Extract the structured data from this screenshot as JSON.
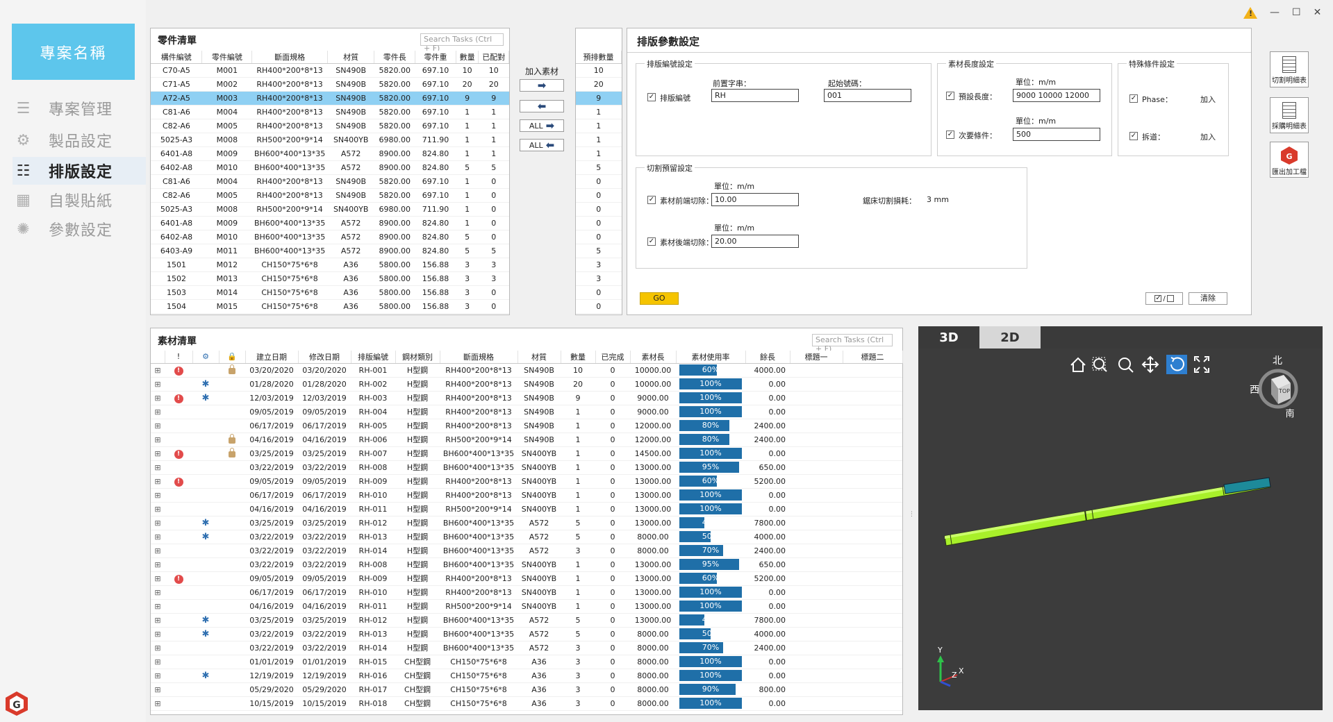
{
  "window": {
    "warning_icon": "warning-icon",
    "minimize": "—",
    "maximize": "☐",
    "close": "✕"
  },
  "sidebar": {
    "project_name": "專案名稱",
    "items": [
      {
        "label": "專案管理",
        "icon": "project-icon"
      },
      {
        "label": "製品設定",
        "icon": "product-icon"
      },
      {
        "label": "排版設定",
        "icon": "layout-icon",
        "active": true
      },
      {
        "label": "自製貼紙",
        "icon": "sticker-icon"
      },
      {
        "label": "參數設定",
        "icon": "settings-icon"
      }
    ]
  },
  "parts": {
    "title": "零件清單",
    "search_placeholder": "Search Tasks (Ctrl + F)",
    "columns": [
      "構件編號",
      "零件編號",
      "斷面規格",
      "材質",
      "零件長",
      "零件重",
      "數量",
      "已配對"
    ],
    "rows": [
      [
        "C70-A5",
        "M001",
        "RH400*200*8*13",
        "SN490B",
        "5820.00",
        "697.10",
        "10",
        "10"
      ],
      [
        "C71-A5",
        "M002",
        "RH400*200*8*13",
        "SN490B",
        "5820.00",
        "697.10",
        "20",
        "20"
      ],
      [
        "A72-A5",
        "M003",
        "RH400*200*8*13",
        "SN490B",
        "5820.00",
        "697.10",
        "9",
        "9"
      ],
      [
        "C81-A6",
        "M004",
        "RH400*200*8*13",
        "SN490B",
        "5820.00",
        "697.10",
        "1",
        "1"
      ],
      [
        "C82-A6",
        "M005",
        "RH400*200*8*13",
        "SN490B",
        "5820.00",
        "697.10",
        "1",
        "1"
      ],
      [
        "5025-A3",
        "M008",
        "RH500*200*9*14",
        "SN400YB",
        "6980.00",
        "711.90",
        "1",
        "1"
      ],
      [
        "6401-A8",
        "M009",
        "BH600*400*13*35",
        "A572",
        "8900.00",
        "824.80",
        "1",
        "1"
      ],
      [
        "6402-A8",
        "M010",
        "BH600*400*13*35",
        "A572",
        "8900.00",
        "824.80",
        "5",
        "5"
      ],
      [
        "C81-A6",
        "M004",
        "RH400*200*8*13",
        "SN490B",
        "5820.00",
        "697.10",
        "1",
        "0"
      ],
      [
        "C82-A6",
        "M005",
        "RH400*200*8*13",
        "SN490B",
        "5820.00",
        "697.10",
        "1",
        "0"
      ],
      [
        "5025-A3",
        "M008",
        "RH500*200*9*14",
        "SN400YB",
        "6980.00",
        "711.90",
        "1",
        "0"
      ],
      [
        "6401-A8",
        "M009",
        "BH600*400*13*35",
        "A572",
        "8900.00",
        "824.80",
        "1",
        "0"
      ],
      [
        "6402-A8",
        "M010",
        "BH600*400*13*35",
        "A572",
        "8900.00",
        "824.80",
        "5",
        "0"
      ],
      [
        "6403-A9",
        "M011",
        "BH600*400*13*35",
        "A572",
        "8900.00",
        "824.80",
        "5",
        "5"
      ],
      [
        "1501",
        "M012",
        "CH150*75*6*8",
        "A36",
        "5800.00",
        "156.88",
        "3",
        "3"
      ],
      [
        "1502",
        "M013",
        "CH150*75*6*8",
        "A36",
        "5800.00",
        "156.88",
        "3",
        "3"
      ],
      [
        "1503",
        "M014",
        "CH150*75*6*8",
        "A36",
        "5800.00",
        "156.88",
        "3",
        "0"
      ],
      [
        "1504",
        "M015",
        "CH150*75*6*8",
        "A36",
        "5800.00",
        "156.88",
        "3",
        "0"
      ]
    ],
    "selected_row": 2
  },
  "transfer": {
    "add_label": "加入素材",
    "right": "➡",
    "left": "⬅",
    "all_right": "ALL",
    "all_left": "ALL"
  },
  "prelist": {
    "title": "預排數量",
    "values": [
      "10",
      "20",
      "9",
      "1",
      "1",
      "1",
      "1",
      "5",
      "0",
      "0",
      "0",
      "0",
      "0",
      "5",
      "3",
      "3",
      "0",
      "0"
    ]
  },
  "params": {
    "title": "排版參數設定",
    "numbering": {
      "title": "排版編號設定",
      "checkbox": "排版編號",
      "prefix_label": "前置字串：",
      "prefix": "RH",
      "start_label": "起始號碼：",
      "start": "001"
    },
    "length": {
      "title": "素材長度設定",
      "unit1": "單位：m/m",
      "preset_label": "預設長度：",
      "preset": "9000  10000  12000",
      "unit2": "單位：m/m",
      "minimum_label": "次要條件：",
      "minimum": "500"
    },
    "special": {
      "title": "特殊條件設定",
      "phase_label": "Phase：",
      "phase_value": "加入",
      "splice_label": "拆道：",
      "splice_value": "加入"
    },
    "cut": {
      "title": "切割預留設定",
      "unit1": "單位：m/m",
      "front_label": "素材前端切除：",
      "front": "10.00",
      "kerf_label": "鋸床切割損耗：",
      "kerf": "3 mm",
      "unit2": "單位：m/m",
      "back_label": "素材後端切除：",
      "back": "20.00"
    },
    "go": "GO",
    "clear": "清除"
  },
  "tools": [
    {
      "label": "切割明細表"
    },
    {
      "label": "採購明細表"
    },
    {
      "label": "匯出加工檔"
    }
  ],
  "materials": {
    "title": "素材清單",
    "search_placeholder": "Search Tasks (Ctrl + F)",
    "columns": [
      "!",
      "⚙",
      "🔒",
      "建立日期",
      "修改日期",
      "排版編號",
      "鋼材類別",
      "斷面規格",
      "材質",
      "數量",
      "已完成",
      "素材長",
      "素材使用率",
      "餘長",
      "標題一",
      "標題二"
    ],
    "rows": [
      {
        "warn": true,
        "gear": false,
        "lock": true,
        "c": "03/20/2020",
        "m": "03/20/2020",
        "id": "RH-001",
        "type": "H型鋼",
        "spec": "RH400*200*8*13",
        "mat": "SN490B",
        "qty": "10",
        "done": "0",
        "len": "10000.00",
        "use": 60,
        "rem": "4000.00"
      },
      {
        "warn": false,
        "gear": true,
        "lock": false,
        "c": "01/28/2020",
        "m": "01/28/2020",
        "id": "RH-002",
        "type": "H型鋼",
        "spec": "RH400*200*8*13",
        "mat": "SN490B",
        "qty": "20",
        "done": "0",
        "len": "10000.00",
        "use": 100,
        "rem": "0.00"
      },
      {
        "warn": true,
        "gear": true,
        "lock": false,
        "c": "12/03/2019",
        "m": "12/03/2019",
        "id": "RH-003",
        "type": "H型鋼",
        "spec": "RH400*200*8*13",
        "mat": "SN490B",
        "qty": "9",
        "done": "0",
        "len": "9000.00",
        "use": 100,
        "rem": "0.00"
      },
      {
        "warn": false,
        "gear": false,
        "lock": false,
        "c": "09/05/2019",
        "m": "09/05/2019",
        "id": "RH-004",
        "type": "H型鋼",
        "spec": "RH400*200*8*13",
        "mat": "SN490B",
        "qty": "1",
        "done": "0",
        "len": "9000.00",
        "use": 100,
        "rem": "0.00"
      },
      {
        "warn": false,
        "gear": false,
        "lock": false,
        "c": "06/17/2019",
        "m": "06/17/2019",
        "id": "RH-005",
        "type": "H型鋼",
        "spec": "RH400*200*8*13",
        "mat": "SN490B",
        "qty": "1",
        "done": "0",
        "len": "12000.00",
        "use": 80,
        "rem": "2400.00"
      },
      {
        "warn": false,
        "gear": false,
        "lock": true,
        "c": "04/16/2019",
        "m": "04/16/2019",
        "id": "RH-006",
        "type": "H型鋼",
        "spec": "RH500*200*9*14",
        "mat": "SN490B",
        "qty": "1",
        "done": "0",
        "len": "12000.00",
        "use": 80,
        "rem": "2400.00"
      },
      {
        "warn": true,
        "gear": false,
        "lock": true,
        "c": "03/25/2019",
        "m": "03/25/2019",
        "id": "RH-007",
        "type": "H型鋼",
        "spec": "BH600*400*13*35",
        "mat": "SN400YB",
        "qty": "1",
        "done": "0",
        "len": "14500.00",
        "use": 100,
        "rem": "0.00"
      },
      {
        "warn": false,
        "gear": false,
        "lock": false,
        "c": "03/22/2019",
        "m": "03/22/2019",
        "id": "RH-008",
        "type": "H型鋼",
        "spec": "BH600*400*13*35",
        "mat": "SN400YB",
        "qty": "1",
        "done": "0",
        "len": "13000.00",
        "use": 95,
        "rem": "650.00"
      },
      {
        "warn": true,
        "gear": false,
        "lock": false,
        "c": "09/05/2019",
        "m": "09/05/2019",
        "id": "RH-009",
        "type": "H型鋼",
        "spec": "RH400*200*8*13",
        "mat": "SN400YB",
        "qty": "1",
        "done": "0",
        "len": "13000.00",
        "use": 60,
        "rem": "5200.00"
      },
      {
        "warn": false,
        "gear": false,
        "lock": false,
        "c": "06/17/2019",
        "m": "06/17/2019",
        "id": "RH-010",
        "type": "H型鋼",
        "spec": "RH400*200*8*13",
        "mat": "SN400YB",
        "qty": "1",
        "done": "0",
        "len": "13000.00",
        "use": 100,
        "rem": "0.00"
      },
      {
        "warn": false,
        "gear": false,
        "lock": false,
        "c": "04/16/2019",
        "m": "04/16/2019",
        "id": "RH-011",
        "type": "H型鋼",
        "spec": "RH500*200*9*14",
        "mat": "SN400YB",
        "qty": "1",
        "done": "0",
        "len": "13000.00",
        "use": 100,
        "rem": "0.00"
      },
      {
        "warn": false,
        "gear": true,
        "lock": false,
        "c": "03/25/2019",
        "m": "03/25/2019",
        "id": "RH-012",
        "type": "H型鋼",
        "spec": "BH600*400*13*35",
        "mat": "A572",
        "qty": "5",
        "done": "0",
        "len": "13000.00",
        "use": 40,
        "rem": "7800.00"
      },
      {
        "warn": false,
        "gear": true,
        "lock": false,
        "c": "03/22/2019",
        "m": "03/22/2019",
        "id": "RH-013",
        "type": "H型鋼",
        "spec": "BH600*400*13*35",
        "mat": "A572",
        "qty": "5",
        "done": "0",
        "len": "8000.00",
        "use": 50,
        "rem": "4000.00"
      },
      {
        "warn": false,
        "gear": false,
        "lock": false,
        "c": "03/22/2019",
        "m": "03/22/2019",
        "id": "RH-014",
        "type": "H型鋼",
        "spec": "BH600*400*13*35",
        "mat": "A572",
        "qty": "3",
        "done": "0",
        "len": "8000.00",
        "use": 70,
        "rem": "2400.00"
      },
      {
        "warn": false,
        "gear": false,
        "lock": false,
        "c": "03/22/2019",
        "m": "03/22/2019",
        "id": "RH-008",
        "type": "H型鋼",
        "spec": "BH600*400*13*35",
        "mat": "SN400YB",
        "qty": "1",
        "done": "0",
        "len": "13000.00",
        "use": 95,
        "rem": "650.00"
      },
      {
        "warn": true,
        "gear": false,
        "lock": false,
        "c": "09/05/2019",
        "m": "09/05/2019",
        "id": "RH-009",
        "type": "H型鋼",
        "spec": "RH400*200*8*13",
        "mat": "SN400YB",
        "qty": "1",
        "done": "0",
        "len": "13000.00",
        "use": 60,
        "rem": "5200.00"
      },
      {
        "warn": false,
        "gear": false,
        "lock": false,
        "c": "06/17/2019",
        "m": "06/17/2019",
        "id": "RH-010",
        "type": "H型鋼",
        "spec": "RH400*200*8*13",
        "mat": "SN400YB",
        "qty": "1",
        "done": "0",
        "len": "13000.00",
        "use": 100,
        "rem": "0.00"
      },
      {
        "warn": false,
        "gear": false,
        "lock": false,
        "c": "04/16/2019",
        "m": "04/16/2019",
        "id": "RH-011",
        "type": "H型鋼",
        "spec": "RH500*200*9*14",
        "mat": "SN400YB",
        "qty": "1",
        "done": "0",
        "len": "13000.00",
        "use": 100,
        "rem": "0.00"
      },
      {
        "warn": false,
        "gear": true,
        "lock": false,
        "c": "03/25/2019",
        "m": "03/25/2019",
        "id": "RH-012",
        "type": "H型鋼",
        "spec": "BH600*400*13*35",
        "mat": "A572",
        "qty": "5",
        "done": "0",
        "len": "13000.00",
        "use": 40,
        "rem": "7800.00"
      },
      {
        "warn": false,
        "gear": true,
        "lock": false,
        "c": "03/22/2019",
        "m": "03/22/2019",
        "id": "RH-013",
        "type": "H型鋼",
        "spec": "BH600*400*13*35",
        "mat": "A572",
        "qty": "5",
        "done": "0",
        "len": "8000.00",
        "use": 50,
        "rem": "4000.00"
      },
      {
        "warn": false,
        "gear": false,
        "lock": false,
        "c": "03/22/2019",
        "m": "03/22/2019",
        "id": "RH-014",
        "type": "H型鋼",
        "spec": "BH600*400*13*35",
        "mat": "A572",
        "qty": "3",
        "done": "0",
        "len": "8000.00",
        "use": 70,
        "rem": "2400.00"
      },
      {
        "warn": false,
        "gear": false,
        "lock": false,
        "c": "01/01/2019",
        "m": "01/01/2019",
        "id": "RH-015",
        "type": "CH型鋼",
        "spec": "CH150*75*6*8",
        "mat": "A36",
        "qty": "3",
        "done": "0",
        "len": "8000.00",
        "use": 100,
        "rem": "0.00"
      },
      {
        "warn": false,
        "gear": true,
        "lock": false,
        "c": "12/19/2019",
        "m": "12/19/2019",
        "id": "RH-016",
        "type": "CH型鋼",
        "spec": "CH150*75*6*8",
        "mat": "A36",
        "qty": "3",
        "done": "0",
        "len": "8000.00",
        "use": 100,
        "rem": "0.00"
      },
      {
        "warn": false,
        "gear": false,
        "lock": false,
        "c": "05/29/2020",
        "m": "05/29/2020",
        "id": "RH-017",
        "type": "CH型鋼",
        "spec": "CH150*75*6*8",
        "mat": "A36",
        "qty": "3",
        "done": "0",
        "len": "8000.00",
        "use": 90,
        "rem": "800.00"
      },
      {
        "warn": false,
        "gear": false,
        "lock": false,
        "c": "10/15/2019",
        "m": "10/15/2019",
        "id": "RH-018",
        "type": "CH型鋼",
        "spec": "CH150*75*6*8",
        "mat": "A36",
        "qty": "3",
        "done": "0",
        "len": "8000.00",
        "use": 100,
        "rem": "0.00"
      }
    ]
  },
  "viewer": {
    "tab_3d": "3D",
    "tab_2d": "2D",
    "compass": {
      "north": "北",
      "west": "西",
      "south": "南",
      "top": "TOP"
    },
    "axes": {
      "y": "Y",
      "z": "Z",
      "x": "X"
    },
    "tools": [
      "home-icon",
      "zoom-window-icon",
      "zoom-icon",
      "pan-icon",
      "rotate-icon",
      "fullscreen-icon"
    ],
    "colors": {
      "bar": "#a8f02a",
      "bar_end": "#1d8a9a",
      "background": "#3c3c3c"
    }
  }
}
